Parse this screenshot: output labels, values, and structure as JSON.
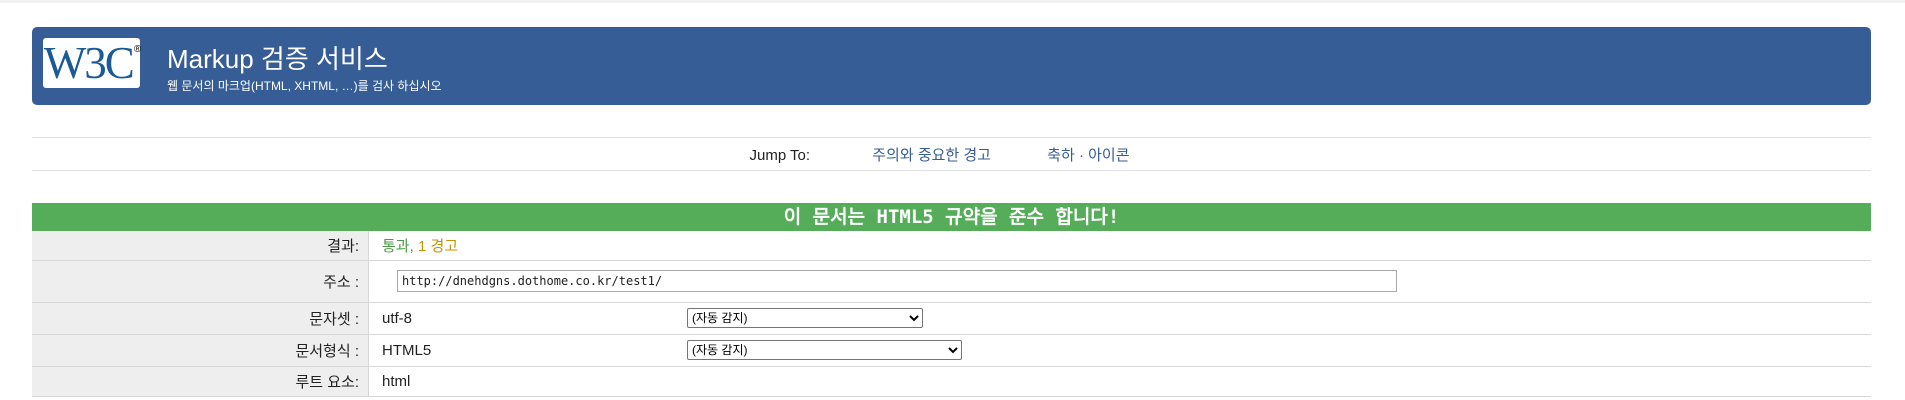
{
  "header": {
    "logo_text": "W3C",
    "logo_mark": "®",
    "title": "Markup 검증 서비스",
    "subtitle": "웹 문서의 마크업(HTML, XHTML, …)를 검사 하십시오"
  },
  "jump": {
    "label": "Jump To:",
    "links": [
      "주의와 중요한 경고",
      "축하 · 아이콘"
    ]
  },
  "result": {
    "banner": "이 문서는 HTML5 규약을 준수 합니다!",
    "rows": {
      "result_label": "결과:",
      "result_pass": "통과,",
      "result_warn": "1 경고",
      "address_label": "주소 :",
      "address_value": "http://dnehdgns.dothome.co.kr/test1/",
      "charset_label": "문자셋 :",
      "charset_value": "utf-8",
      "charset_select": "(자동 감지)",
      "doctype_label": "문서형식 :",
      "doctype_value": "HTML5",
      "doctype_select": "(자동 감지)",
      "root_label": "루트 요소:",
      "root_value": "html"
    }
  },
  "colors": {
    "banner_blue": "#365d95",
    "pass_green": "#55ad59",
    "warn_gold": "#c69500",
    "link_blue": "#365d95"
  }
}
